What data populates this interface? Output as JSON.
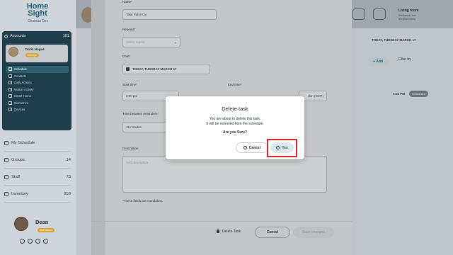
{
  "sidebar": {
    "logo_line1": "Home",
    "logo_line2": "Sight",
    "org": "Chateau Dev",
    "accounts_label": "Accounts",
    "accounts_count": "101",
    "user_name": "Doris Hogue",
    "user_badge": "Manage",
    "nav_items": [
      "Schedule",
      "Contacts",
      "Daily Actions",
      "Motion Activity",
      "Smart Home",
      "Biometrics",
      "Devices"
    ],
    "rows": [
      {
        "label": "My Schedule",
        "count": ""
      },
      {
        "label": "Groups",
        "count": "14"
      },
      {
        "label": "Staff",
        "count": "73"
      },
      {
        "label": "Inventory",
        "count": "250"
      }
    ],
    "profile_name": "Dean",
    "profile_badge": "Staff Admin"
  },
  "background": {
    "living_room": "Living room",
    "living_sub": "Wellness Hub ele@services",
    "date_chip": "TODAY, TUESDAY MARCH 17",
    "add_label": "+ Add",
    "filter_label": "Filter by",
    "row_time": "9:00 PM",
    "row_status": "Scheduled"
  },
  "form": {
    "name_label": "Name*",
    "name_value": "Take Pulse Ox",
    "repeats_label": "Repeats*",
    "repeats_placeholder": "Select repeat",
    "date_label": "Date*",
    "date_value": "TODAY, TUESDAY MARCH 17",
    "start_label": "Start time*",
    "start_value": "9:00 pm",
    "end_label": "End time*",
    "timezone_value": "don (GMT)",
    "between_label": "Time between reminders*",
    "between_value": "15 minutes",
    "description_label": "Description",
    "description_placeholder": "Add description",
    "mandatory_note": "*These fields are mandatory.",
    "delete_task": "Delete Task",
    "cancel": "Cancel",
    "save": "Save changes"
  },
  "modal": {
    "title": "Delete task",
    "line1": "You are about to delete this task.",
    "line2": "It will be removed from the schedule.",
    "question": "Are you Sure?",
    "cancel_label": "Cancel",
    "yes_label": "Yes"
  },
  "colors": {
    "accent": "#1b5f76",
    "highlight": "#e02525",
    "sidebar_dark": "#1d3e4a"
  }
}
